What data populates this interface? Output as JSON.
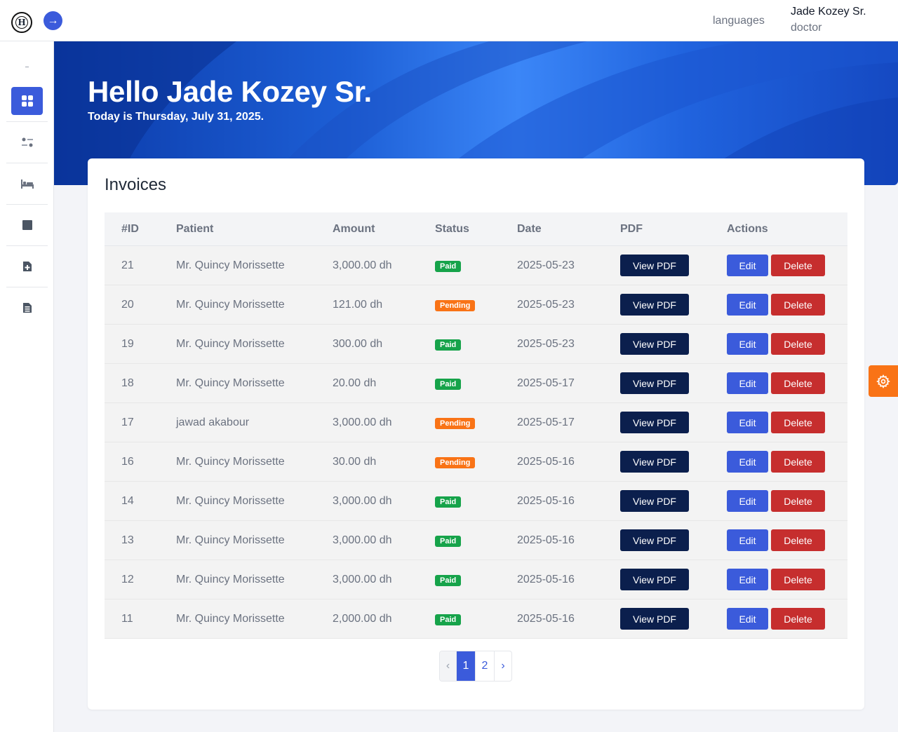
{
  "header": {
    "logo_letter": "H",
    "languages": "languages",
    "user_name": "Jade Kozey Sr.",
    "user_role": "doctor"
  },
  "sidebar": {
    "items": [
      {
        "icon": "dashboard-icon",
        "active": true
      },
      {
        "icon": "sliders-icon",
        "active": false
      },
      {
        "icon": "bed-icon",
        "active": false
      },
      {
        "icon": "square-icon",
        "active": false
      },
      {
        "icon": "file-plus-icon",
        "active": false
      },
      {
        "icon": "file-text-icon",
        "active": false
      }
    ]
  },
  "hero": {
    "greeting": "Hello Jade Kozey Sr.",
    "today": "Today is Thursday, July 31, 2025."
  },
  "invoices": {
    "title": "Invoices",
    "columns": [
      "#ID",
      "Patient",
      "Amount",
      "Status",
      "Date",
      "PDF",
      "Actions"
    ],
    "rows": [
      {
        "id": "21",
        "patient": "Mr. Quincy Morissette",
        "amount": "3,000.00 dh",
        "status": "Paid",
        "date": "2025-05-23"
      },
      {
        "id": "20",
        "patient": "Mr. Quincy Morissette",
        "amount": "121.00 dh",
        "status": "Pending",
        "date": "2025-05-23"
      },
      {
        "id": "19",
        "patient": "Mr. Quincy Morissette",
        "amount": "300.00 dh",
        "status": "Paid",
        "date": "2025-05-23"
      },
      {
        "id": "18",
        "patient": "Mr. Quincy Morissette",
        "amount": "20.00 dh",
        "status": "Paid",
        "date": "2025-05-17"
      },
      {
        "id": "17",
        "patient": "jawad akabour",
        "amount": "3,000.00 dh",
        "status": "Pending",
        "date": "2025-05-17"
      },
      {
        "id": "16",
        "patient": "Mr. Quincy Morissette",
        "amount": "30.00 dh",
        "status": "Pending",
        "date": "2025-05-16"
      },
      {
        "id": "14",
        "patient": "Mr. Quincy Morissette",
        "amount": "3,000.00 dh",
        "status": "Paid",
        "date": "2025-05-16"
      },
      {
        "id": "13",
        "patient": "Mr. Quincy Morissette",
        "amount": "3,000.00 dh",
        "status": "Paid",
        "date": "2025-05-16"
      },
      {
        "id": "12",
        "patient": "Mr. Quincy Morissette",
        "amount": "3,000.00 dh",
        "status": "Paid",
        "date": "2025-05-16"
      },
      {
        "id": "11",
        "patient": "Mr. Quincy Morissette",
        "amount": "2,000.00 dh",
        "status": "Paid",
        "date": "2025-05-16"
      }
    ],
    "view_pdf_label": "View PDF",
    "edit_label": "Edit",
    "delete_label": "Delete"
  },
  "pagination": {
    "prev": "‹",
    "pages": [
      "1",
      "2"
    ],
    "current": "1",
    "next": "›"
  },
  "colors": {
    "accent": "#3b5bdb",
    "paid": "#16a34a",
    "pending": "#f97316",
    "danger": "#c62e2e",
    "pdf_button": "#0b1f4d",
    "settings": "#f97316"
  }
}
